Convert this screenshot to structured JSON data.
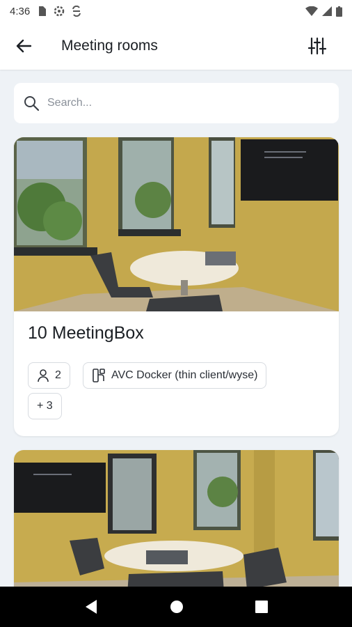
{
  "status_bar": {
    "time": "4:36"
  },
  "app_bar": {
    "title": "Meeting rooms"
  },
  "search": {
    "placeholder": "Search..."
  },
  "rooms": [
    {
      "title": "10 MeetingBox",
      "capacity": "2",
      "equipment": "AVC Docker (thin client/wyse)",
      "more": "+ 3"
    },
    {
      "title": ""
    }
  ],
  "colors": {
    "background": "#eef2f6",
    "card": "#ffffff",
    "wall_yellow": "#c9ad4e",
    "nav_bar": "#000000"
  }
}
